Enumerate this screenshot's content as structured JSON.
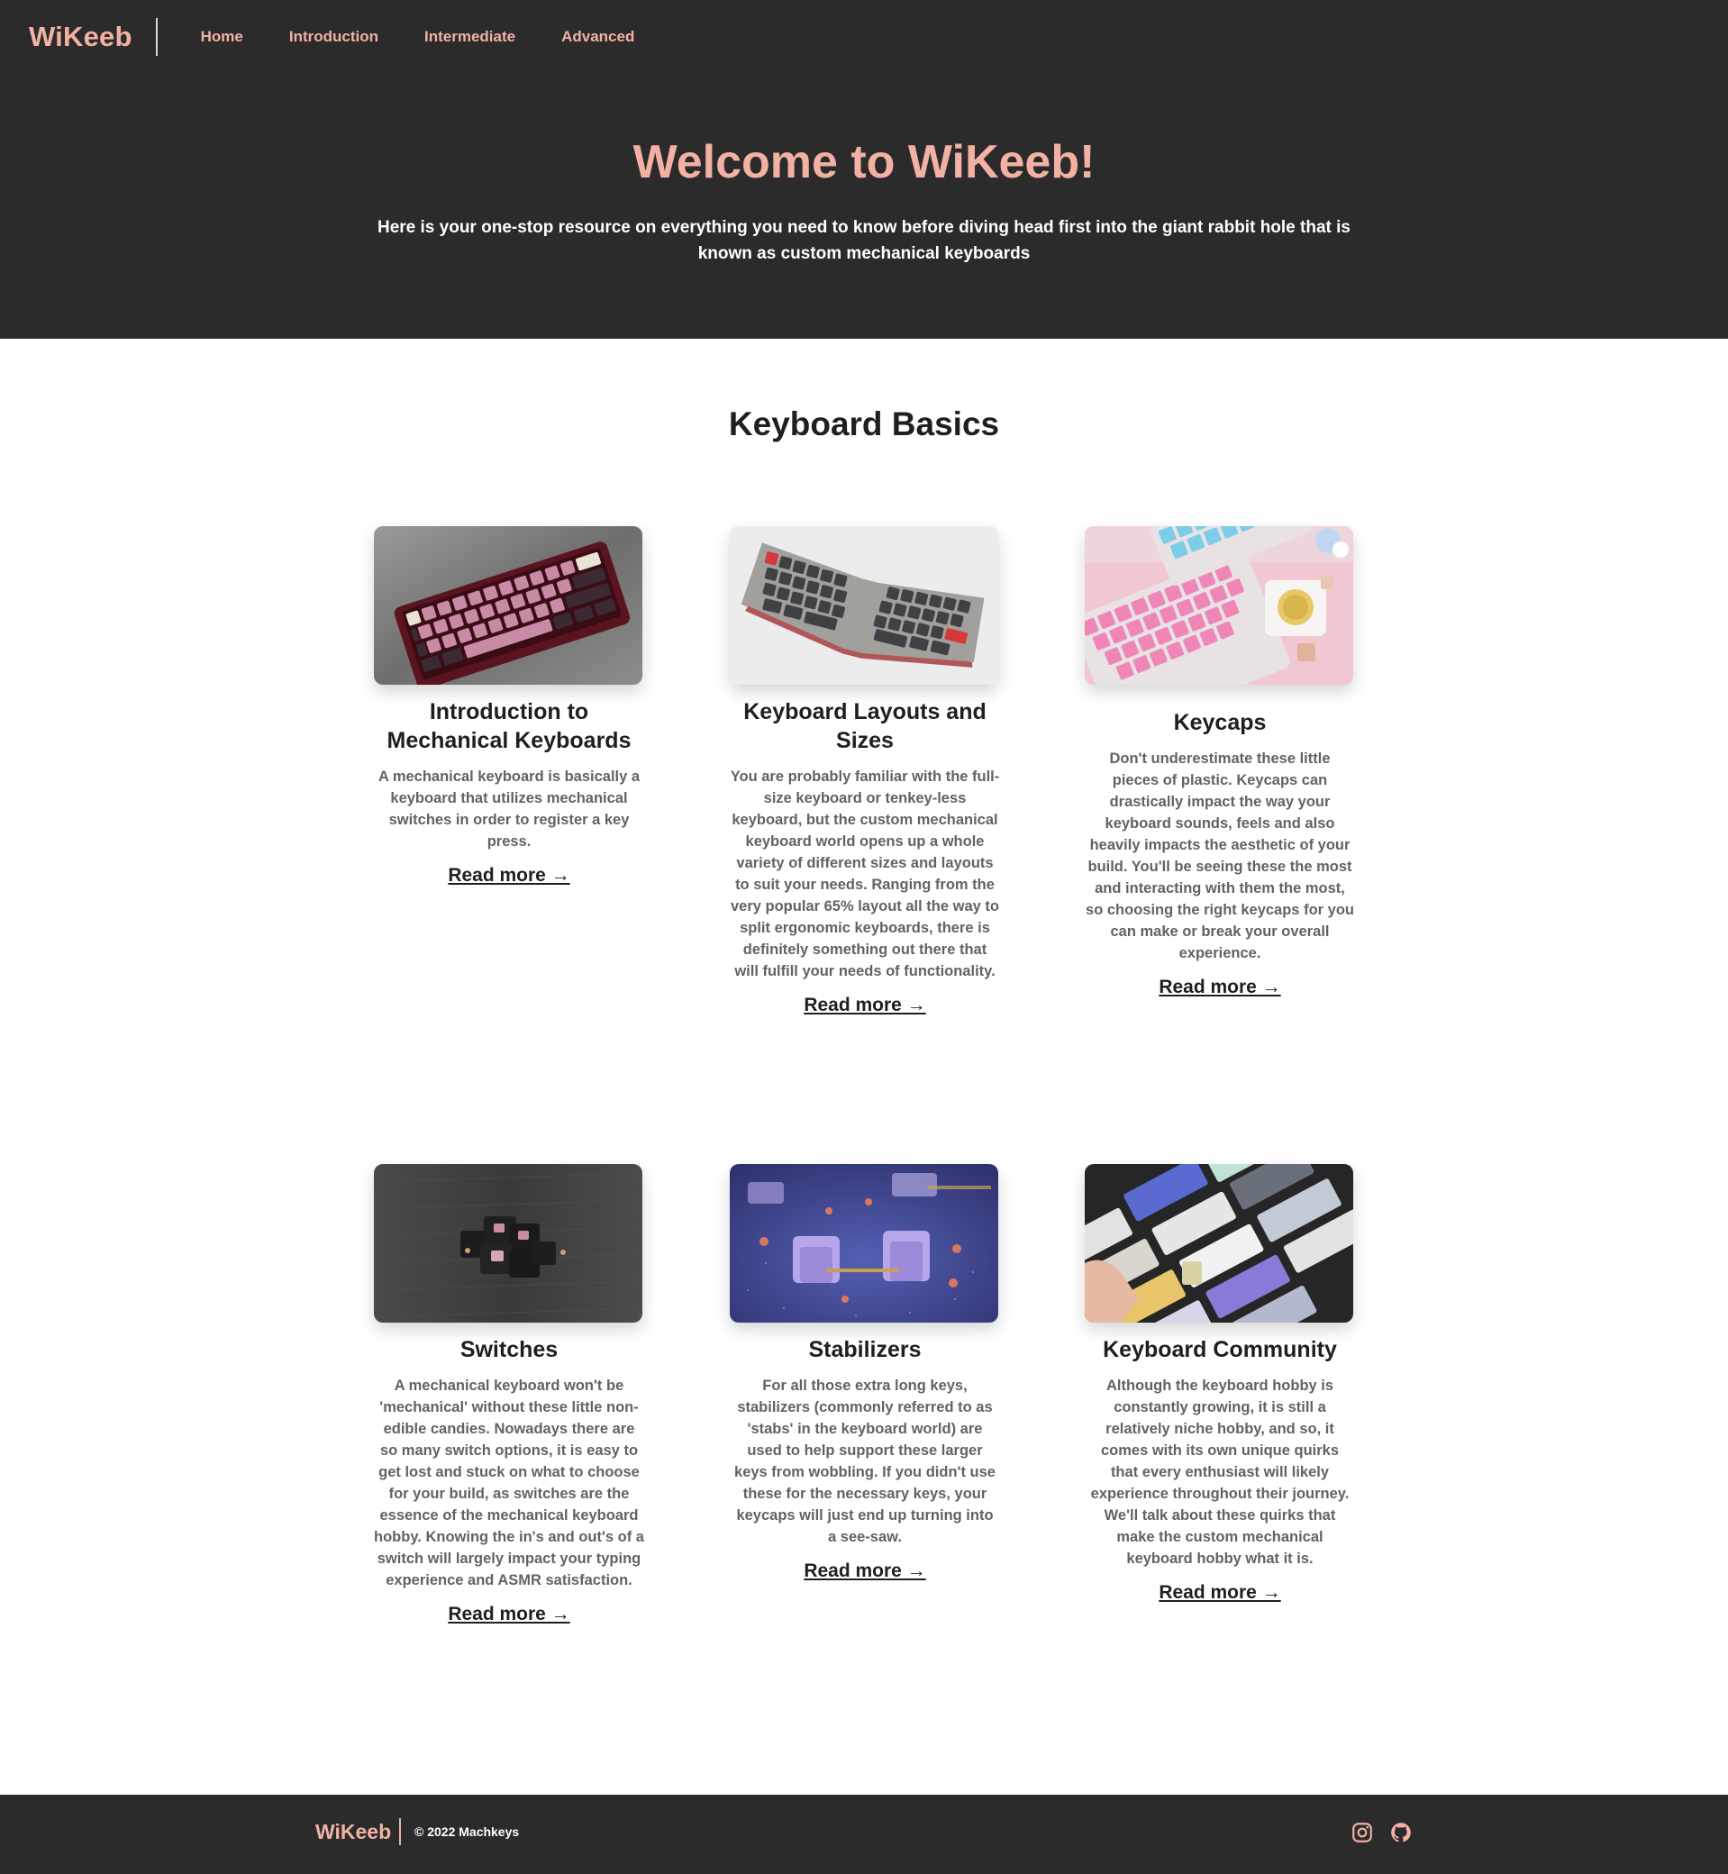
{
  "nav": {
    "brand": "WiKeeb",
    "links": [
      "Home",
      "Introduction",
      "Intermediate",
      "Advanced"
    ]
  },
  "hero": {
    "title": "Welcome to WiKeeb!",
    "subtitle": "Here is your one-stop resource on everything you need to know before diving head first into the giant rabbit hole that is known as custom mechanical keyboards"
  },
  "main": {
    "section_title": "Keyboard Basics",
    "read_more_label": "Read more →",
    "cards": [
      {
        "image": "burgundy-keyboard-photo",
        "title": "Introduction to Mechanical Keyboards",
        "description": "A mechanical keyboard is basically a keyboard that utilizes mechanical switches in order to register a key press."
      },
      {
        "image": "split-ergonomic-keyboard-photo",
        "title": "Keyboard Layouts and Sizes",
        "description": "You are probably familiar with the full-size keyboard or tenkey-less keyboard, but the custom mechanical keyboard world opens up a whole variety of different sizes and layouts to suit your needs. Ranging from the very popular 65% layout all the way to split ergonomic keyboards, there is definitely something out there that will fulfill your needs of functionality."
      },
      {
        "image": "pink-keycaps-photo",
        "title": "Keycaps",
        "description": "Don't underestimate these little pieces of plastic. Keycaps can drastically impact the way your keyboard sounds, feels and also heavily impacts the aesthetic of your build. You'll be seeing these the most and interacting with them the most, so choosing the right keycaps for you can make or break your overall experience."
      },
      {
        "image": "switches-pile-photo",
        "title": "Switches",
        "description": "A mechanical keyboard won't be 'mechanical' without these little non-edible candies. Nowadays there are so many switch options, it is easy to get lost and stuck on what to choose for your build, as switches are the essence of the mechanical keyboard hobby. Knowing the in's and out's of a switch will largely impact your typing experience and ASMR satisfaction."
      },
      {
        "image": "purple-stabilizers-photo",
        "title": "Stabilizers",
        "description": "For all those extra long keys, stabilizers (commonly referred to as 'stabs' in the keyboard world) are used to help support these larger keys from wobbling. If you didn't use these for the necessary keys, your keycaps will just end up turning into a see-saw."
      },
      {
        "image": "keyboard-collection-photo",
        "title": "Keyboard Community",
        "description": "Although the keyboard hobby is constantly growing, it is still a relatively niche hobby, and so, it comes with its own unique quirks that every enthusiast will likely experience throughout their journey. We'll talk about these quirks that make the custom mechanical keyboard hobby what it is."
      }
    ]
  },
  "footer": {
    "brand": "WiKeeb",
    "copyright": "© 2022 Machkeys",
    "icons": [
      "instagram-icon",
      "github-icon"
    ]
  },
  "colors": {
    "accent": "#f2b1a3",
    "dark": "#2b2b2b",
    "body_text": "#5f6368"
  }
}
